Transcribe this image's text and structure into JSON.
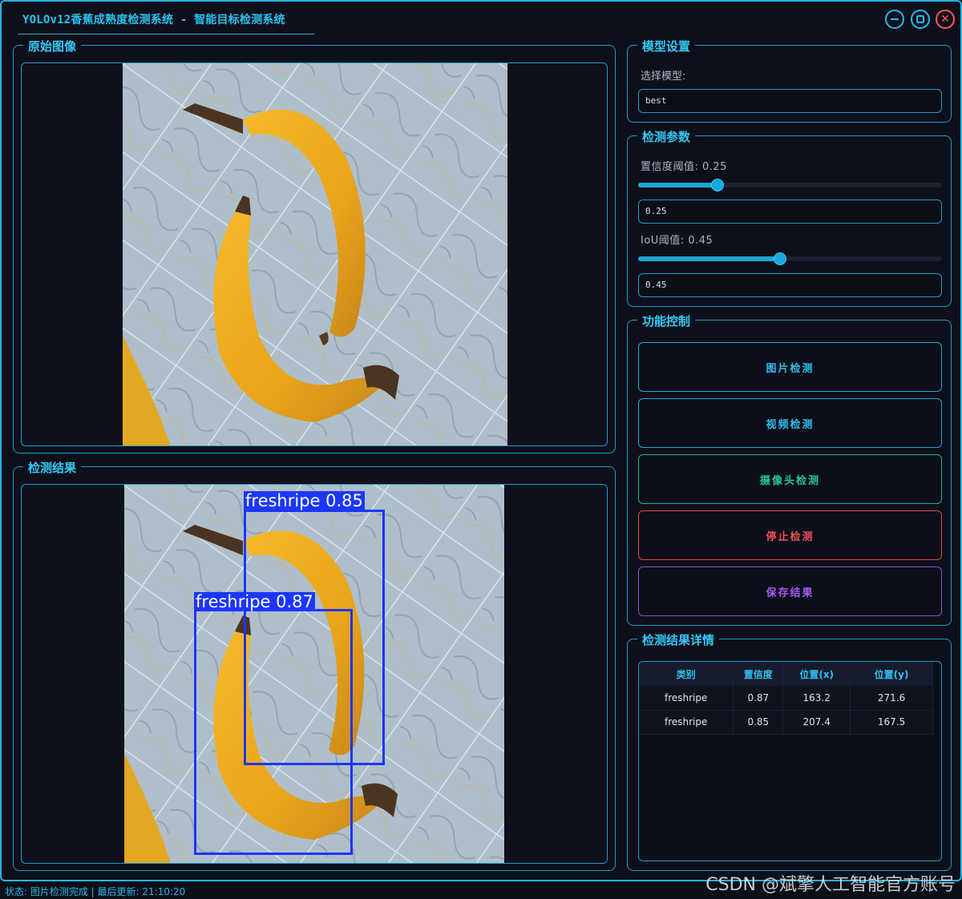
{
  "window": {
    "title": "YOLOv12香蕉成熟度检测系统 - 智能目标检测系统"
  },
  "original_panel": {
    "title": "原始图像"
  },
  "result_panel": {
    "title": "检测结果",
    "detections": [
      {
        "label": "freshripe 0.85"
      },
      {
        "label": "freshripe 0.87"
      }
    ]
  },
  "model_settings": {
    "title": "模型设置",
    "select_label": "选择模型:",
    "model_value": "best"
  },
  "detect_params": {
    "title": "检测参数",
    "conf_label": "置信度阈值: 0.25",
    "conf_value": "0.25",
    "conf_level": 0.25,
    "iou_label": "IoU阈值: 0.45",
    "iou_value": "0.45",
    "iou_level": 0.45
  },
  "controls": {
    "title": "功能控制",
    "image_detect": "图片检测",
    "video_detect": "视频检测",
    "camera_detect": "摄像头检测",
    "stop_detect": "停止检测",
    "save_result": "保存结果"
  },
  "results_table": {
    "title": "检测结果详情",
    "headers": [
      "类别",
      "置信度",
      "位置(x)",
      "位置(y)"
    ],
    "rows": [
      [
        "freshripe",
        "0.87",
        "163.2",
        "271.6"
      ],
      [
        "freshripe",
        "0.85",
        "207.4",
        "167.5"
      ]
    ]
  },
  "status": {
    "text": "状态: 图片检测完成 | 最后更新: 21:10:20"
  },
  "watermark": "CSDN @斌擎人工智能官方账号",
  "colors": {
    "accent": "#1fb6e6",
    "detection_box": "#1c36ff",
    "green_button": "#1fb58c",
    "red_button": "#e0474f",
    "purple_button": "#8e4ed0"
  }
}
